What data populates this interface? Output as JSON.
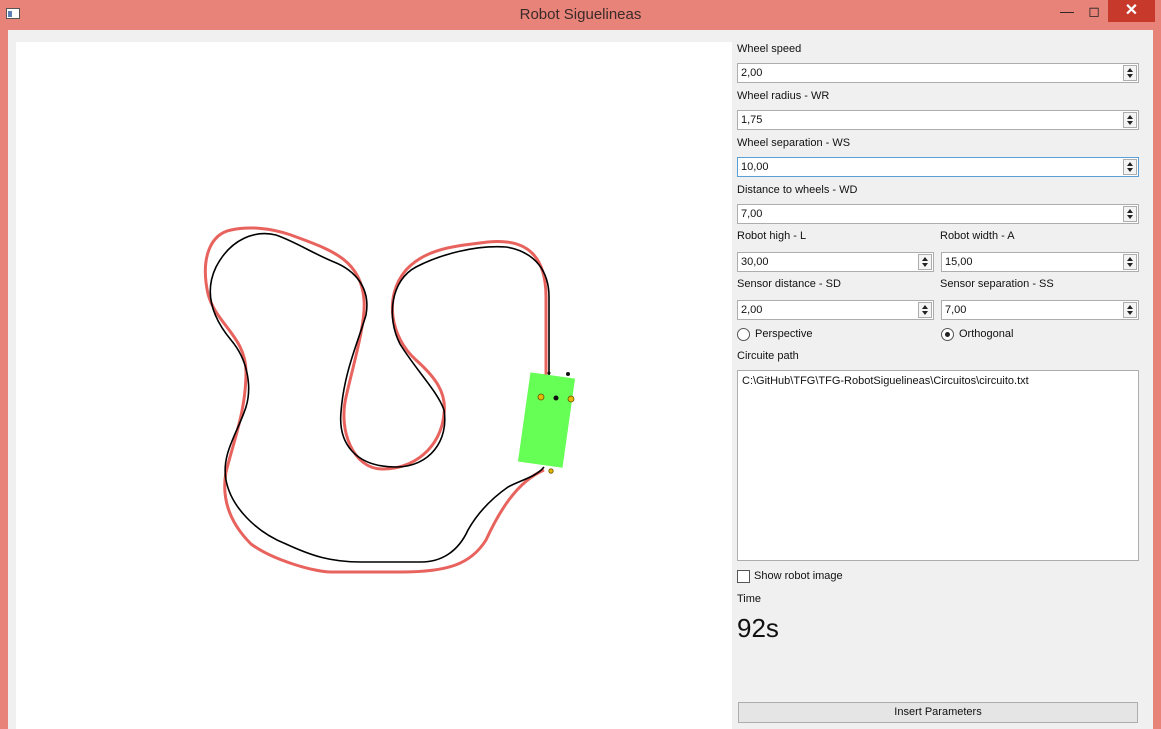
{
  "window": {
    "title": "Robot Siguelineas",
    "min_icon": "minimize-icon",
    "max_icon": "maximize-icon",
    "close_icon": "close-icon"
  },
  "params": {
    "wheel_speed": {
      "label": "Wheel speed",
      "value": "2,00"
    },
    "wheel_radius": {
      "label": "Wheel radius - WR",
      "value": "1,75"
    },
    "wheel_separation": {
      "label": "Wheel separation - WS",
      "value": "10,00"
    },
    "distance_to_wheels": {
      "label": "Distance to wheels - WD",
      "value": "7,00"
    },
    "robot_high": {
      "label": "Robot high - L",
      "value": "30,00"
    },
    "robot_width": {
      "label": "Robot width - A",
      "value": "15,00"
    },
    "sensor_distance": {
      "label": "Sensor distance - SD",
      "value": "2,00"
    },
    "sensor_separation": {
      "label": "Sensor separation - SS",
      "value": "7,00"
    }
  },
  "view": {
    "perspective_label": "Perspective",
    "orthogonal_label": "Orthogonal",
    "selected": "Orthogonal"
  },
  "circuit": {
    "label": "Circuite path",
    "path": "C:\\GitHub\\TFG\\TFG-RobotSiguelineas\\Circuitos\\circuito.txt"
  },
  "show_robot_image": {
    "label": "Show robot image",
    "checked": false
  },
  "time": {
    "label": "Time",
    "value": "92s"
  },
  "insert_button": "Insert Parameters",
  "colors": {
    "track": "#000000",
    "robot_path": "#e8635e",
    "robot_body": "#66ff55",
    "sensor": "#e6b800",
    "title_bar": "#e8837a"
  }
}
